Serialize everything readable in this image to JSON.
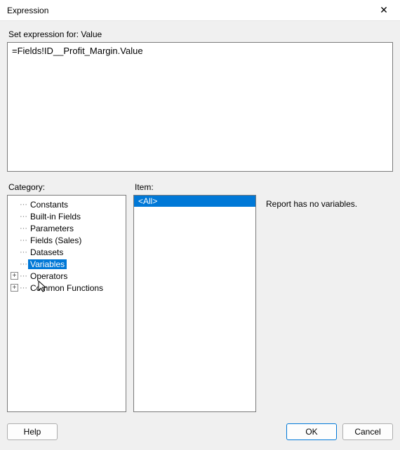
{
  "window": {
    "title": "Expression",
    "close_glyph": "✕"
  },
  "expression": {
    "label": "Set expression for: Value",
    "value": "=Fields!ID__Profit_Margin.Value"
  },
  "columns": {
    "category_label": "Category:",
    "item_label": "Item:"
  },
  "category_tree": [
    {
      "label": "Constants",
      "expander": null,
      "selected": false
    },
    {
      "label": "Built-in Fields",
      "expander": null,
      "selected": false
    },
    {
      "label": "Parameters",
      "expander": null,
      "selected": false
    },
    {
      "label": "Fields (Sales)",
      "expander": null,
      "selected": false
    },
    {
      "label": "Datasets",
      "expander": null,
      "selected": false
    },
    {
      "label": "Variables",
      "expander": null,
      "selected": true
    },
    {
      "label": "Operators",
      "expander": "+",
      "selected": false
    },
    {
      "label": "Common Functions",
      "expander": "+",
      "selected": false
    }
  ],
  "items": [
    {
      "label": "<All>",
      "selected": true
    }
  ],
  "description": "Report has no variables.",
  "buttons": {
    "help": "Help",
    "ok": "OK",
    "cancel": "Cancel"
  }
}
